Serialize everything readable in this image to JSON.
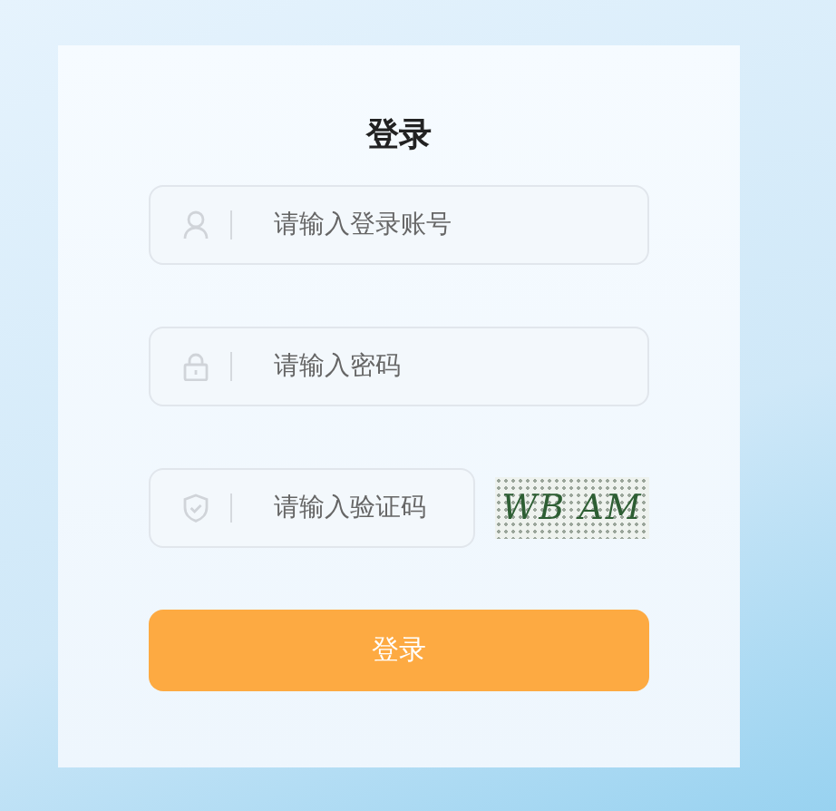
{
  "title": "登录",
  "fields": [
    {
      "kind": "user",
      "placeholder": "请输入登录账号"
    },
    {
      "kind": "lock",
      "placeholder": "请输入密码"
    }
  ],
  "captcha": {
    "placeholder": "请输入验证码",
    "code": "WB AM"
  },
  "button": "登录"
}
